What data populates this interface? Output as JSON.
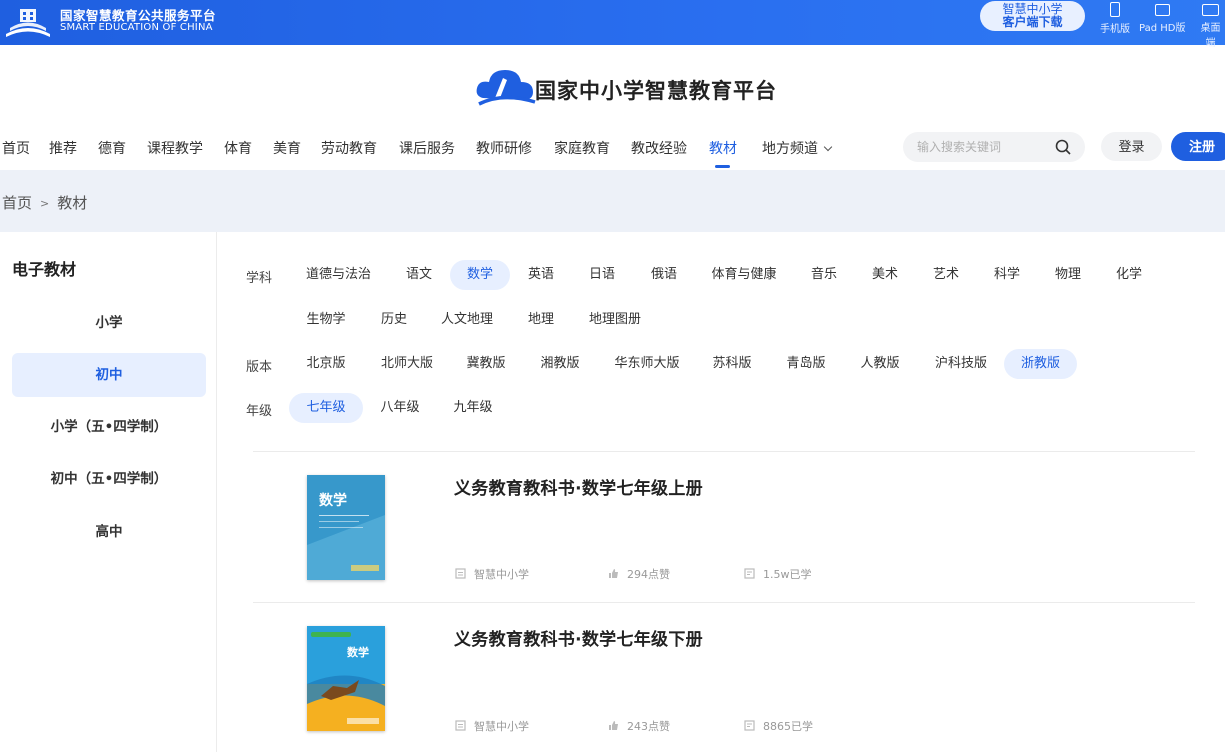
{
  "topbar": {
    "brand_cn": "国家智慧教育公共服务平台",
    "brand_en": "SMART EDUCATION OF CHINA",
    "download_line1": "智慧中小学",
    "download_line2": "客户端下载",
    "devices": [
      {
        "label": "手机版",
        "icon": "phone-icon"
      },
      {
        "label": "Pad HD版",
        "icon": "tablet-icon"
      },
      {
        "label": "桌面端",
        "icon": "desktop-icon"
      }
    ]
  },
  "header": {
    "site_title": "国家中小学智慧教育平台"
  },
  "nav": {
    "items": [
      "首页",
      "推荐",
      "德育",
      "课程教学",
      "体育",
      "美育",
      "劳动教育",
      "课后服务",
      "教师研修",
      "家庭教育",
      "教改经验",
      "教材",
      "地方频道"
    ],
    "active": "教材",
    "search_placeholder": "输入搜索关键词",
    "login": "登录",
    "register": "注册"
  },
  "breadcrumb": {
    "home": "首页",
    "sep": ">",
    "current": "教材"
  },
  "sidebar": {
    "title": "电子教材",
    "items": [
      "小学",
      "初中",
      "小学（五•四学制）",
      "初中（五•四学制）",
      "高中"
    ],
    "active": "初中"
  },
  "filters": {
    "subject_label": "学科",
    "subjects_row1": [
      "道德与法治",
      "语文",
      "数学",
      "英语",
      "日语",
      "俄语",
      "体育与健康",
      "音乐",
      "美术",
      "艺术",
      "科学",
      "物理",
      "化学"
    ],
    "subjects_row2": [
      "生物学",
      "历史",
      "人文地理",
      "地理",
      "地理图册"
    ],
    "subject_active": "数学",
    "edition_label": "版本",
    "editions": [
      "北京版",
      "北师大版",
      "冀教版",
      "湘教版",
      "华东师大版",
      "苏科版",
      "青岛版",
      "人教版",
      "沪科技版",
      "浙教版"
    ],
    "edition_active": "浙教版",
    "grade_label": "年级",
    "grades": [
      "七年级",
      "八年级",
      "九年级"
    ],
    "grade_active": "七年级"
  },
  "books": [
    {
      "title": "义务教育教科书·数学七年级上册",
      "publisher": "智慧中小学",
      "likes": "294点赞",
      "learned": "1.5w已学",
      "cover_text": "数学"
    },
    {
      "title": "义务教育教科书·数学七年级下册",
      "publisher": "智慧中小学",
      "likes": "243点赞",
      "learned": "8865已学",
      "cover_text": "数学"
    }
  ],
  "colors": {
    "accent": "#1f5fe0",
    "active_bg": "#e7efff",
    "crumb_bg": "#edf1f8"
  }
}
